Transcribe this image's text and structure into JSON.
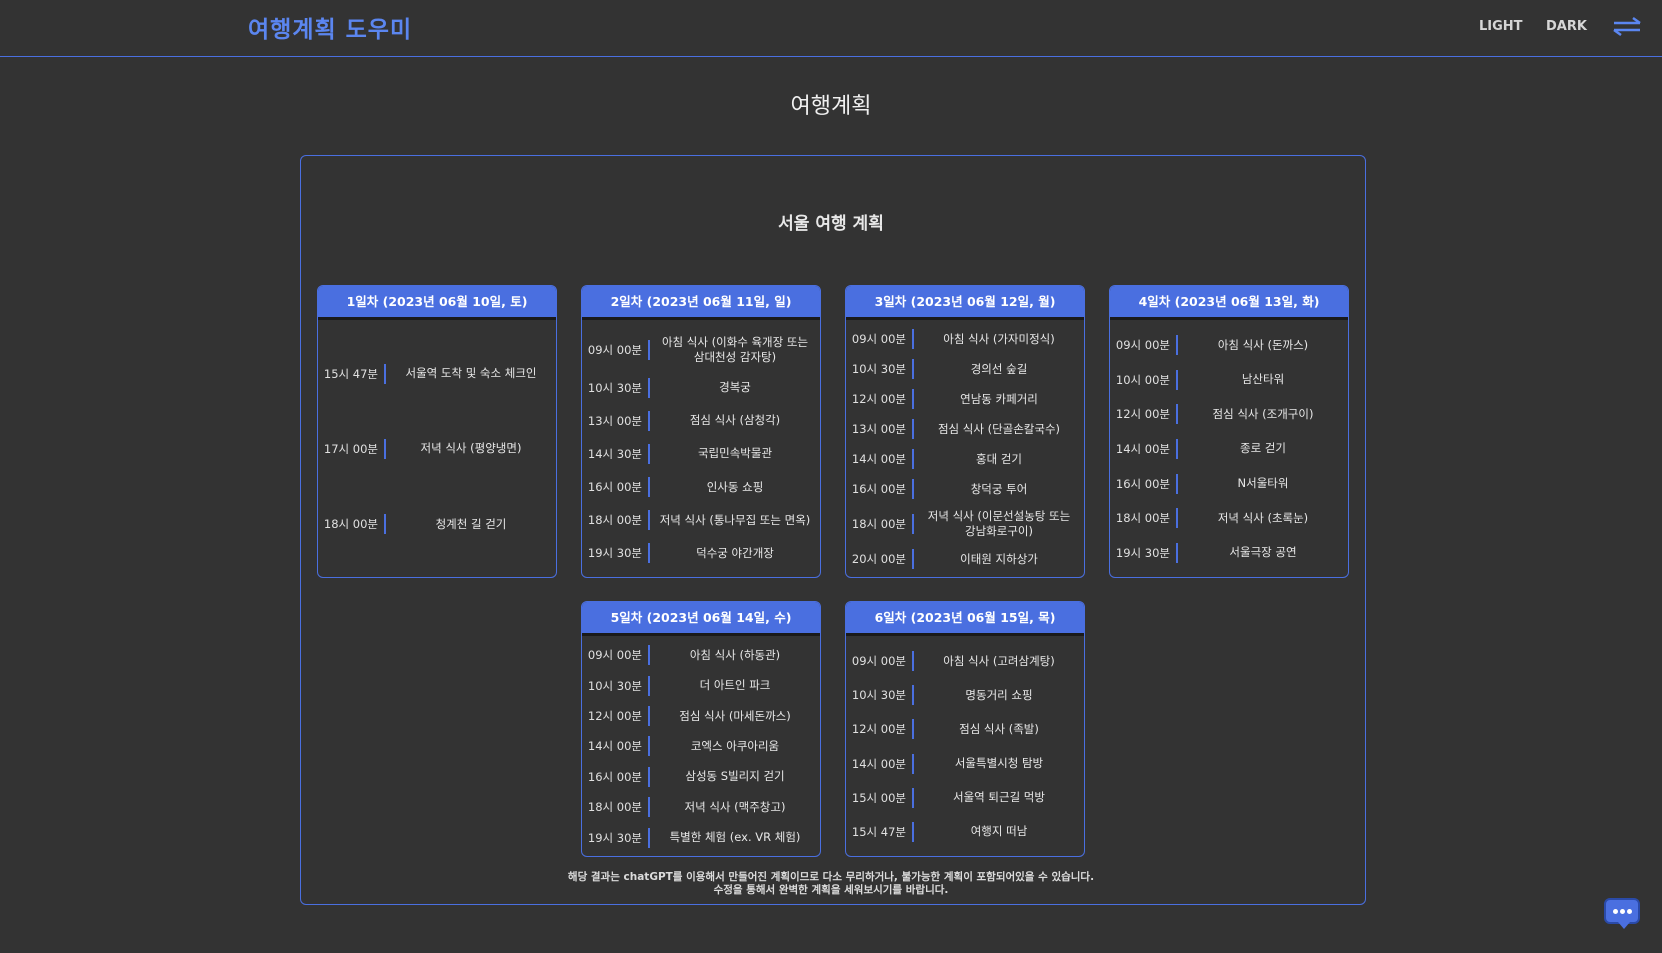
{
  "header": {
    "logo": "여행계획 도우미",
    "nav": {
      "light": "LIGHT",
      "dark": "DARK"
    },
    "icon": "swap-arrows-icon"
  },
  "page": {
    "title": "여행계획",
    "plan_title": "서울 여행 계획",
    "footnote_1": "해당 결과는 chatGPT를 이용해서 만들어진 계획이므로 다소 무리하거나, 불가능한 계획이 포함되어있을 수 있습니다.",
    "footnote_2": "수정을 통해서 완벽한 계획을 세워보시기를 바랍니다."
  },
  "days": [
    {
      "title": "1일차 (2023년 06월 10일, 토)",
      "items": [
        {
          "time": "15시 47분",
          "activity": "서울역 도착 및 숙소 체크인"
        },
        {
          "time": "17시 00분",
          "activity": "저녁 식사 (평양냉면)"
        },
        {
          "time": "18시 00분",
          "activity": "청계천 길 걷기"
        }
      ]
    },
    {
      "title": "2일차 (2023년 06월 11일, 일)",
      "items": [
        {
          "time": "09시 00분",
          "activity": "아침 식사 (이화수 육개장 또는 삼대천성 감자탕)"
        },
        {
          "time": "10시 30분",
          "activity": "경복궁"
        },
        {
          "time": "13시 00분",
          "activity": "점심 식사 (삼청각)"
        },
        {
          "time": "14시 30분",
          "activity": "국립민속박물관"
        },
        {
          "time": "16시 00분",
          "activity": "인사동 쇼핑"
        },
        {
          "time": "18시 00분",
          "activity": "저녁 식사 (통나무집 또는 면옥)"
        },
        {
          "time": "19시 30분",
          "activity": "덕수궁 야간개장"
        }
      ]
    },
    {
      "title": "3일차 (2023년 06월 12일, 월)",
      "items": [
        {
          "time": "09시 00분",
          "activity": "아침 식사 (가자미정식)"
        },
        {
          "time": "10시 30분",
          "activity": "경의선 숲길"
        },
        {
          "time": "12시 00분",
          "activity": "연남동 카페거리"
        },
        {
          "time": "13시 00분",
          "activity": "점심 식사 (단골손칼국수)"
        },
        {
          "time": "14시 00분",
          "activity": "홍대 걷기"
        },
        {
          "time": "16시 00분",
          "activity": "창덕궁 투어"
        },
        {
          "time": "18시 00분",
          "activity": "저녁 식사 (이문선설농탕 또는 강남화로구이)"
        },
        {
          "time": "20시 00분",
          "activity": "이태원 지하상가"
        }
      ]
    },
    {
      "title": "4일차 (2023년 06월 13일, 화)",
      "items": [
        {
          "time": "09시 00분",
          "activity": "아침 식사 (돈까스)"
        },
        {
          "time": "10시 00분",
          "activity": "남산타워"
        },
        {
          "time": "12시 00분",
          "activity": "점심 식사 (조개구이)"
        },
        {
          "time": "14시 00분",
          "activity": "종로 걷기"
        },
        {
          "time": "16시 00분",
          "activity": "N서울타워"
        },
        {
          "time": "18시 00분",
          "activity": "저녁 식사 (초록눈)"
        },
        {
          "time": "19시 30분",
          "activity": "서울극장 공연"
        }
      ]
    },
    {
      "title": "5일차 (2023년 06월 14일, 수)",
      "items": [
        {
          "time": "09시 00분",
          "activity": "아침 식사 (하동관)"
        },
        {
          "time": "10시 30분",
          "activity": "더 아트인 파크"
        },
        {
          "time": "12시 00분",
          "activity": "점심 식사 (마세돈까스)"
        },
        {
          "time": "14시 00분",
          "activity": "코엑스 아쿠아리움"
        },
        {
          "time": "16시 00분",
          "activity": "삼성동 S빌리지 걷기"
        },
        {
          "time": "18시 00분",
          "activity": "저녁 식사 (맥주창고)"
        },
        {
          "time": "19시 30분",
          "activity": "특별한 체험 (ex. VR 체험)"
        }
      ]
    },
    {
      "title": "6일차 (2023년 06월 15일, 목)",
      "items": [
        {
          "time": "09시 00분",
          "activity": "아침 식사 (고려삼계탕)"
        },
        {
          "time": "10시 30분",
          "activity": "명동거리 쇼핑"
        },
        {
          "time": "12시 00분",
          "activity": "점심 식사 (족발)"
        },
        {
          "time": "14시 00분",
          "activity": "서울특별시청 탐방"
        },
        {
          "time": "15시 00분",
          "activity": "서울역 퇴근길 먹방"
        },
        {
          "time": "15시 47분",
          "activity": "여행지 떠남"
        }
      ]
    }
  ],
  "chat_icon": "chat-bubble-icon"
}
